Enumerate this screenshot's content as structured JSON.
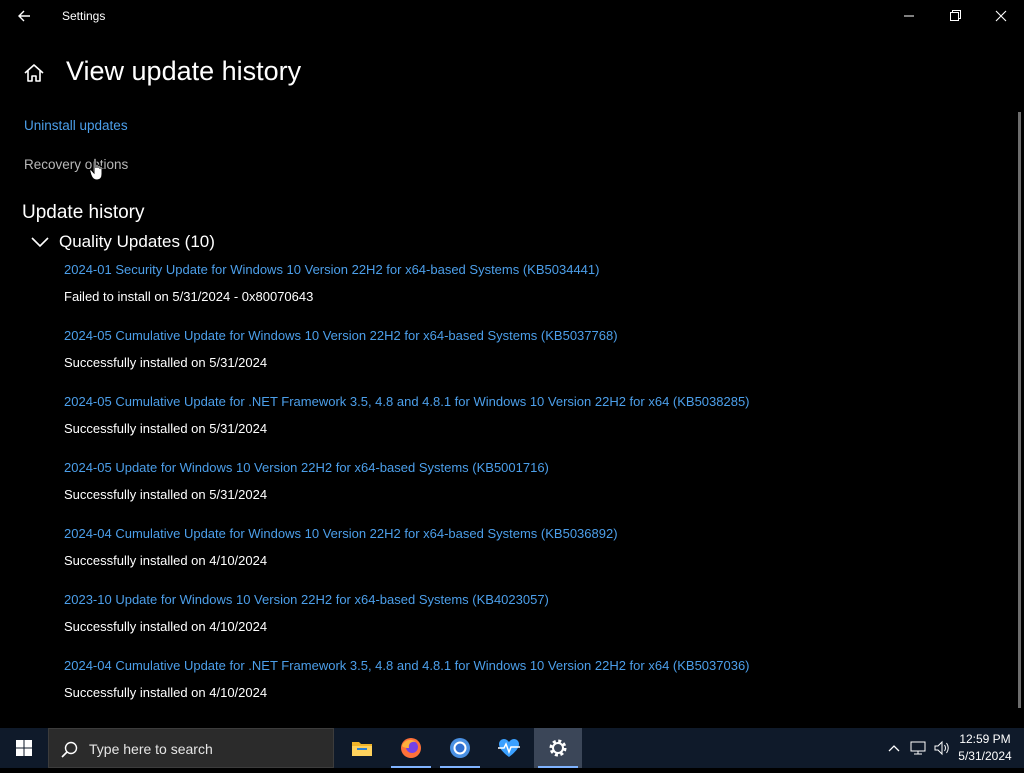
{
  "window": {
    "title": "Settings"
  },
  "header": {
    "title": "View update history"
  },
  "links": {
    "uninstall": "Uninstall updates",
    "recovery": "Recovery options"
  },
  "section": {
    "heading": "Update history"
  },
  "group": {
    "label": "Quality Updates (10)"
  },
  "updates": [
    {
      "title": "2024-01 Security Update for Windows 10 Version 22H2 for x64-based Systems (KB5034441)",
      "status": "Failed to install on 5/31/2024 - 0x80070643"
    },
    {
      "title": "2024-05 Cumulative Update for Windows 10 Version 22H2 for x64-based Systems (KB5037768)",
      "status": "Successfully installed on 5/31/2024"
    },
    {
      "title": "2024-05 Cumulative Update for .NET Framework 3.5, 4.8 and 4.8.1 for Windows 10 Version 22H2 for x64 (KB5038285)",
      "status": "Successfully installed on 5/31/2024"
    },
    {
      "title": "2024-05 Update for Windows 10 Version 22H2 for x64-based Systems (KB5001716)",
      "status": "Successfully installed on 5/31/2024"
    },
    {
      "title": "2024-04 Cumulative Update for Windows 10 Version 22H2 for x64-based Systems (KB5036892)",
      "status": "Successfully installed on 4/10/2024"
    },
    {
      "title": "2023-10 Update for Windows 10 Version 22H2 for x64-based Systems (KB4023057)",
      "status": "Successfully installed on 4/10/2024"
    },
    {
      "title": "2024-04 Cumulative Update for .NET Framework 3.5, 4.8 and 4.8.1 for Windows 10 Version 22H2 for x64 (KB5037036)",
      "status": "Successfully installed on 4/10/2024"
    }
  ],
  "taskbar": {
    "search_placeholder": "Type here to search",
    "time": "12:59 PM",
    "date": "5/31/2024",
    "apps": [
      "file-explorer-icon",
      "firefox-icon",
      "chrome-icon",
      "health-icon",
      "settings-icon"
    ]
  },
  "colors": {
    "accent": "#4c9fea",
    "background": "#000000",
    "taskbar": "#0f1a2a"
  }
}
